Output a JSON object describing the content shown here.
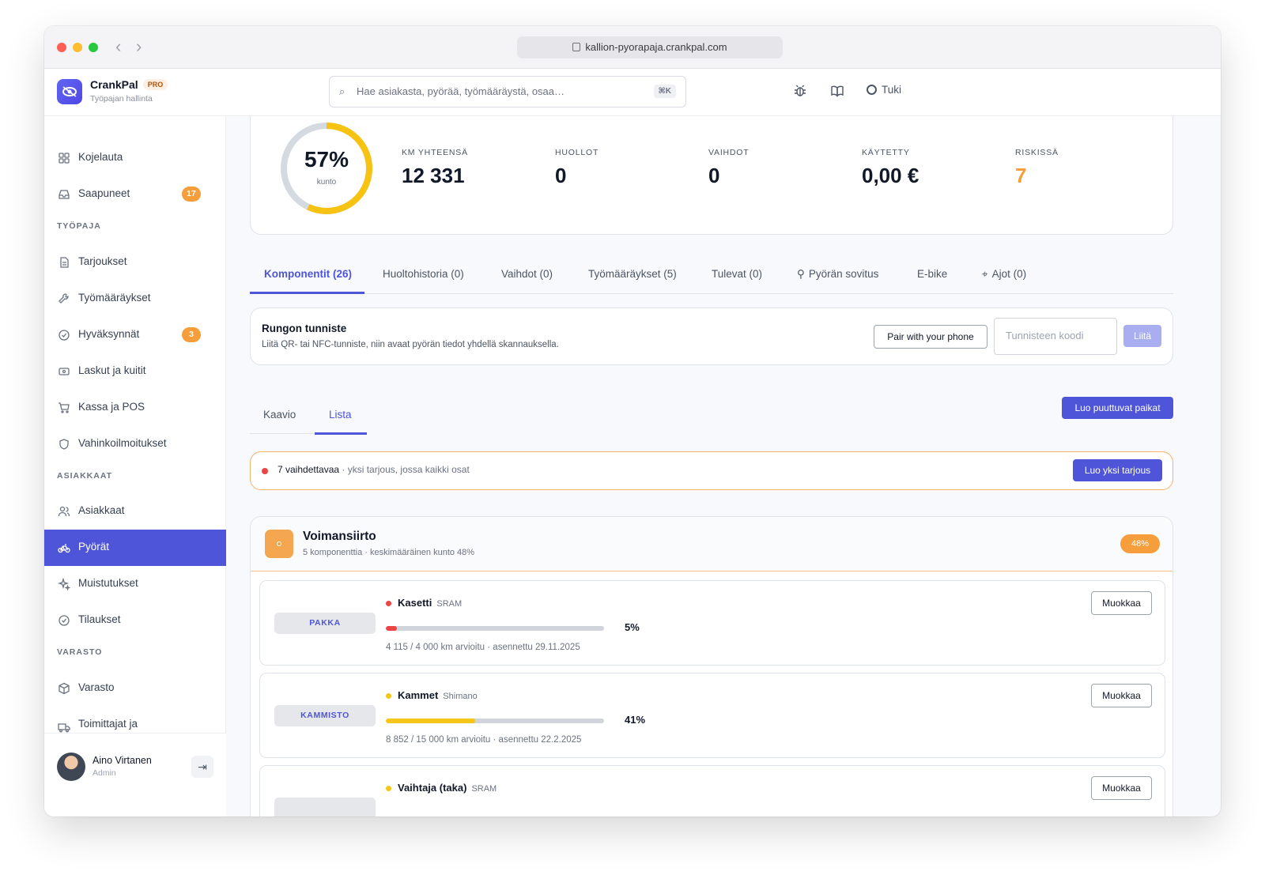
{
  "browser": {
    "url": "kallion-pyorapaja.crankpal.com"
  },
  "app": {
    "name": "CrankPal",
    "plan": "PRO",
    "subtitle": "Työpajan hallinta"
  },
  "header": {
    "search_placeholder": "Hae asiakasta, pyörää, työmääräystä, osaa…",
    "search_shortcut": "⌘K",
    "support_label": "Tuki"
  },
  "sidebar": {
    "items_top": [
      {
        "label": "Kojelauta",
        "icon": "grid-icon"
      },
      {
        "label": "Saapuneet",
        "icon": "inbox-icon",
        "badge": "17"
      }
    ],
    "sections": [
      {
        "title": "TYÖPAJA",
        "items": [
          {
            "label": "Tarjoukset",
            "icon": "document-icon"
          },
          {
            "label": "Työmääräykset",
            "icon": "wrench-icon"
          },
          {
            "label": "Hyväksynnät",
            "icon": "check-circle-icon",
            "badge": "3"
          },
          {
            "label": "Laskut ja kuitit",
            "icon": "receipt-icon"
          },
          {
            "label": "Kassa ja POS",
            "icon": "cart-icon"
          },
          {
            "label": "Vahinkoilmoitukset",
            "icon": "shield-icon"
          }
        ]
      },
      {
        "title": "ASIAKKAAT",
        "items": [
          {
            "label": "Asiakkaat",
            "icon": "users-icon"
          },
          {
            "label": "Pyörät",
            "icon": "bike-icon",
            "active": true
          },
          {
            "label": "Muistutukset",
            "icon": "sparkle-icon"
          },
          {
            "label": "Tilaukset",
            "icon": "check-circle-icon"
          }
        ]
      },
      {
        "title": "VARASTO",
        "items": [
          {
            "label": "Varasto",
            "icon": "box-icon"
          },
          {
            "label": "Toimittajat ja",
            "icon": "truck-icon"
          }
        ]
      }
    ],
    "user": {
      "name": "Aino Virtanen",
      "role": "Admin"
    }
  },
  "stats": {
    "condition_pct": 57,
    "condition_label": "57%",
    "condition_sub": "kunto",
    "items": [
      {
        "key": "KM YHTEENSÄ",
        "value": "12 331"
      },
      {
        "key": "HUOLLOT",
        "value": "0"
      },
      {
        "key": "VAIHDOT",
        "value": "0"
      },
      {
        "key": "KÄYTETTY",
        "value": "0,00 €"
      },
      {
        "key": "RISKISSÄ",
        "value": "7"
      }
    ]
  },
  "tabs": [
    "Komponentit (26)",
    "Huoltohistoria (0)",
    "Vaihdot (0)",
    "Työmääräykset (5)",
    "Tulevat (0)",
    "Pyörän sovitus",
    "E-bike",
    "Ajot (0)"
  ],
  "tag": {
    "title": "Rungon tunniste",
    "description": "Liitä QR- tai NFC-tunniste, niin avaat pyörän tiedot yhdellä skannauksella.",
    "pair_button": "Pair with your phone",
    "code_placeholder": "Tunnisteen koodi",
    "attach_button": "Liitä"
  },
  "view_tabs": [
    "Kaavio",
    "Lista"
  ],
  "create_missing_button": "Luo puuttuvat paikat",
  "alert": {
    "strong": "7 vaihdettavaa",
    "muted": " · yksi tarjous, jossa kaikki osat",
    "button": "Luo yksi tarjous"
  },
  "group": {
    "title": "Voimansiirto",
    "subtitle": "5 komponenttia · keskimääräinen kunto 48%",
    "badge": "48%",
    "components": [
      {
        "type": "PAKKA",
        "name": "Kasetti",
        "brand": "SRAM",
        "pct": 5,
        "pct_label": "5%",
        "color": "#ef4444",
        "meta": "4 115 / 4 000 km arvioitu · asennettu 29.11.2025",
        "edit": "Muokkaa"
      },
      {
        "type": "KAMMISTO",
        "name": "Kammet",
        "brand": "Shimano",
        "pct": 41,
        "pct_label": "41%",
        "color": "#f5c518",
        "meta": "8 852 / 15 000 km arvioitu · asennettu 22.2.2025",
        "edit": "Muokkaa"
      },
      {
        "type": "",
        "name": "Vaihtaja (taka)",
        "brand": "SRAM",
        "pct": 0,
        "pct_label": "",
        "color": "#f5c518",
        "meta": "",
        "edit": "Muokkaa"
      }
    ]
  }
}
